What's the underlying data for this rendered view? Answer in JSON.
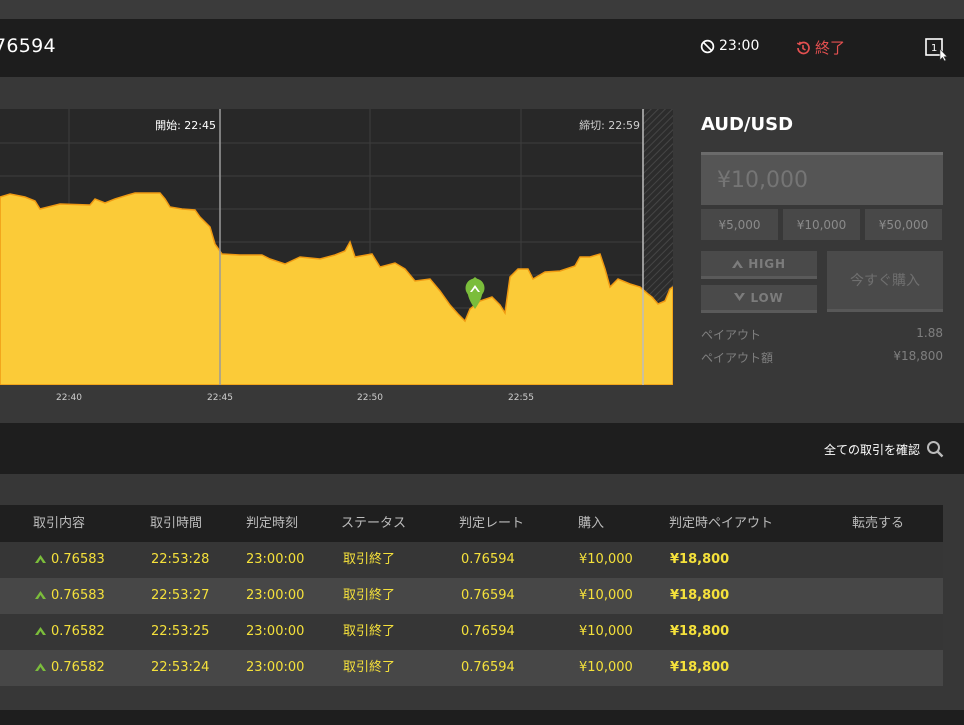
{
  "header": {
    "rate": "76594",
    "timer": "23:00",
    "status": "終了"
  },
  "chart": {
    "start_label": "開始: 22:45",
    "deadline_label": "締切: 22:59",
    "x_ticks": [
      "22:40",
      "22:45",
      "22:50",
      "22:55"
    ],
    "accent_color": "#fbcb38"
  },
  "panel": {
    "pair": "AUD/USD",
    "amount_placeholder": "¥10,000",
    "quick_amounts": [
      "¥5,000",
      "¥10,000",
      "¥50,000"
    ],
    "high_label": "HIGH",
    "low_label": "LOW",
    "buy_now_label": "今すぐ購入",
    "payout_label": "ペイアウト",
    "payout_value": "1.88",
    "payout_amount_label": "ペイアウト額",
    "payout_amount_value": "¥18,800"
  },
  "confirm": {
    "label": "全ての取引を確認"
  },
  "table": {
    "headers": [
      "取引内容",
      "取引時間",
      "判定時刻",
      "ステータス",
      "判定レート",
      "購入",
      "判定時ペイアウト",
      "転売する"
    ],
    "rows": [
      {
        "content": "0.76583",
        "trade_time": "22:53:28",
        "judge_time": "23:00:00",
        "status": "取引終了",
        "rate": "0.76594",
        "purchase": "¥10,000",
        "payout": "¥18,800"
      },
      {
        "content": "0.76583",
        "trade_time": "22:53:27",
        "judge_time": "23:00:00",
        "status": "取引終了",
        "rate": "0.76594",
        "purchase": "¥10,000",
        "payout": "¥18,800"
      },
      {
        "content": "0.76582",
        "trade_time": "22:53:25",
        "judge_time": "23:00:00",
        "status": "取引終了",
        "rate": "0.76594",
        "purchase": "¥10,000",
        "payout": "¥18,800"
      },
      {
        "content": "0.76582",
        "trade_time": "22:53:24",
        "judge_time": "23:00:00",
        "status": "取引終了",
        "rate": "0.76594",
        "purchase": "¥10,000",
        "payout": "¥18,800"
      }
    ]
  }
}
